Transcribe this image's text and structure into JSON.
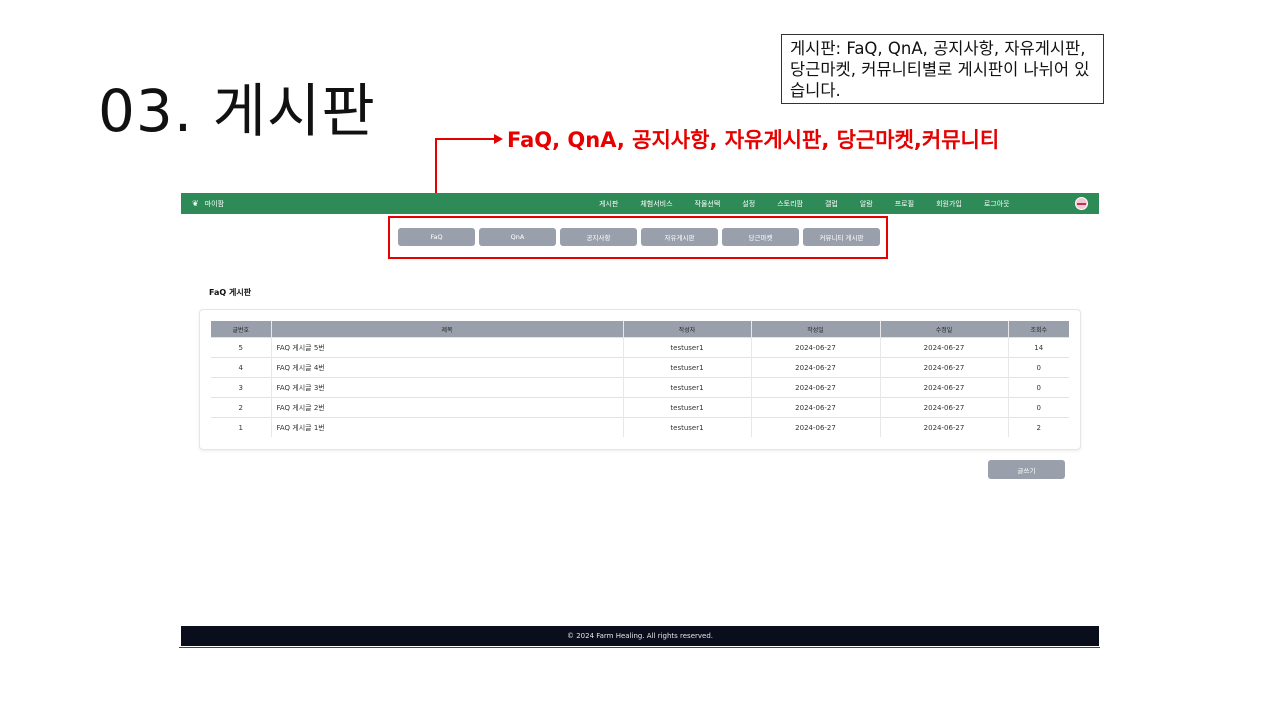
{
  "slide": {
    "title": "03. 게시판",
    "note": "게시판: FaQ, QnA, 공지사항, 자유게시판, 당근마켓, 커뮤니티별로 게시판이 나뉘어 있습니다.",
    "callout": "FaQ, QnA, 공지사항, 자유게시판, 당근마켓,커뮤니티",
    "accent_color": "#e60000"
  },
  "app": {
    "brand": "마이팜",
    "nav_color": "#2e8b57",
    "nav": [
      "게시판",
      "체험서비스",
      "작물선택",
      "설정",
      "스토리팜",
      "갤럽",
      "알람",
      "프로필",
      "회원가입",
      "로그아웃"
    ],
    "subtabs": [
      "FaQ",
      "QnA",
      "공지사항",
      "자유게시판",
      "당근마켓",
      "커뮤니티 게시판"
    ],
    "board_title": "FaQ 게시판",
    "table": {
      "headers": [
        "글번호",
        "제목",
        "작성자",
        "작성일",
        "수정일",
        "조회수"
      ],
      "rows": [
        [
          "5",
          "FAQ 게시글 5번",
          "testuser1",
          "2024-06-27",
          "2024-06-27",
          "14"
        ],
        [
          "4",
          "FAQ 게시글 4번",
          "testuser1",
          "2024-06-27",
          "2024-06-27",
          "0"
        ],
        [
          "3",
          "FAQ 게시글 3번",
          "testuser1",
          "2024-06-27",
          "2024-06-27",
          "0"
        ],
        [
          "2",
          "FAQ 게시글 2번",
          "testuser1",
          "2024-06-27",
          "2024-06-27",
          "0"
        ],
        [
          "1",
          "FAQ 게시글 1번",
          "testuser1",
          "2024-06-27",
          "2024-06-27",
          "2"
        ]
      ]
    },
    "write_button": "글쓰기",
    "footer": "© 2024 Farm Healing. All rights reserved."
  }
}
